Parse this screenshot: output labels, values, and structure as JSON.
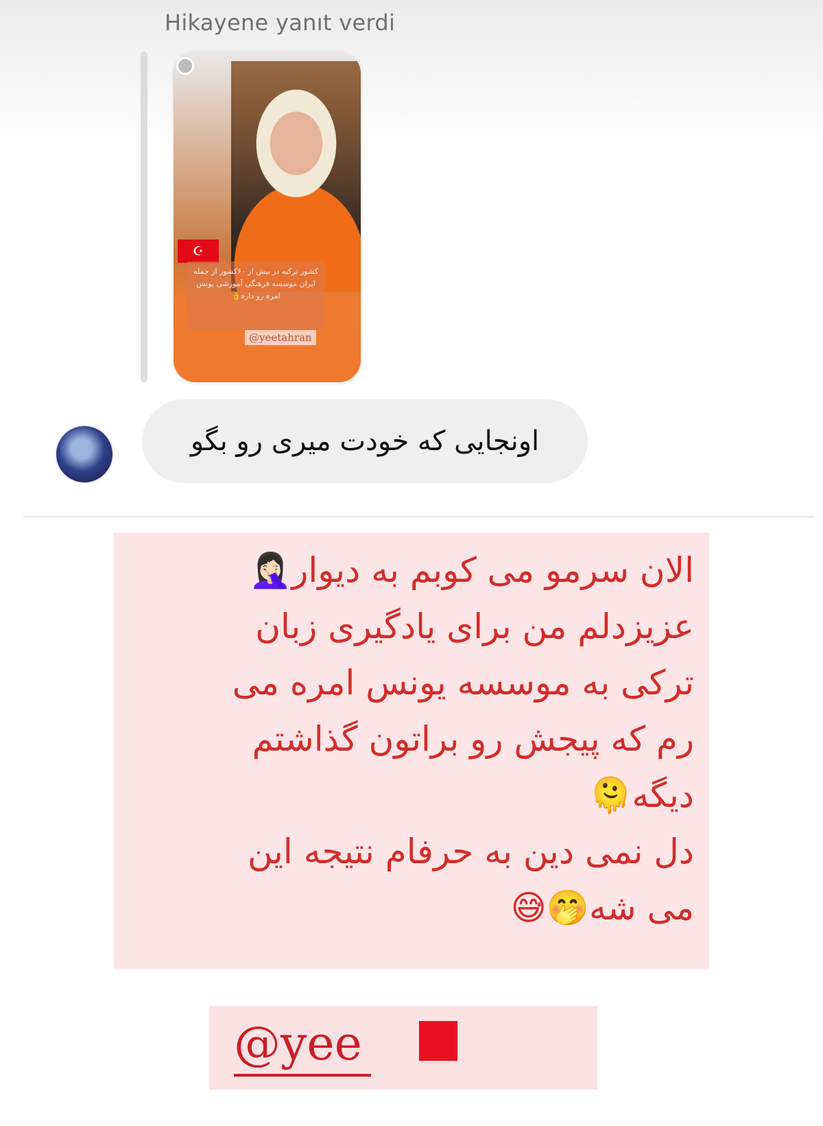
{
  "reply_header": "Hikayene yanıt verdi",
  "story": {
    "overlay_text": "کشور ترکیه در بیش از ۶۰کشور از جمله ایران موسسه فرهنگی آموزشی یونس امره رو داره👌",
    "tag": "@yeetahran",
    "flag_symbol": "☪"
  },
  "message": {
    "text": "اونجایی که خودت میری رو بگو"
  },
  "caption": {
    "lines": [
      "الان سرمو می کوبم به دیوار🤦🏻‍♀️",
      "عزیزدلم من برای یادگیری زبان",
      "ترکی به موسسه یونس امره می",
      "رم که پیجش رو براتون گذاشتم",
      "دیگه🫠",
      "دل نمی دین به حرفام نتیجه این",
      "می شه🤭😅"
    ]
  },
  "handle": {
    "text": "@yee"
  },
  "colors": {
    "caption_text": "#d22c2c",
    "caption_bg": "#fbe5e6",
    "story_orange": "#ef7a2d",
    "redaction": "#e8101e"
  }
}
